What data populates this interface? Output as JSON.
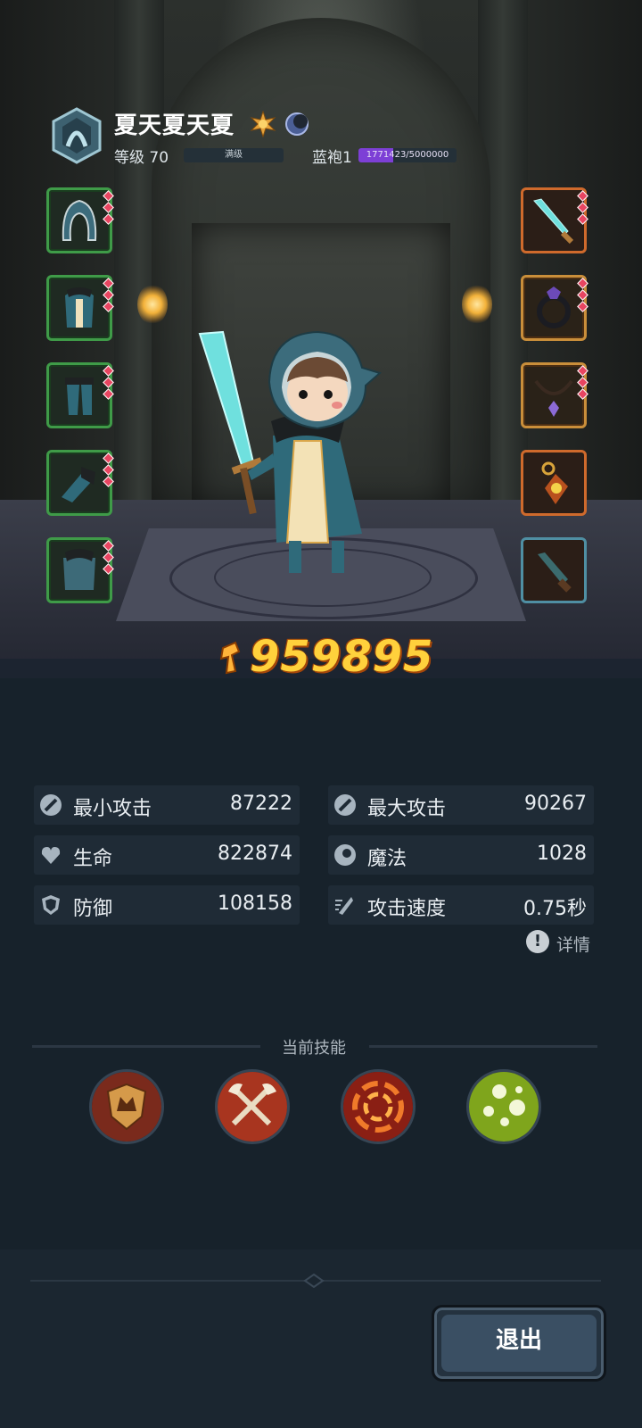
{
  "player": {
    "name": "夏天夏天夏",
    "level_label": "等级 70",
    "level_bar_text": "满级",
    "rank_label": "蓝袍1",
    "rank_progress_text": "1771423/5000000",
    "rank_progress_fraction": 0.354
  },
  "power": {
    "value": "959895"
  },
  "stats": [
    {
      "label": "最小攻击",
      "value": "87222",
      "icon": "sword-icon"
    },
    {
      "label": "最大攻击",
      "value": "90267",
      "icon": "sword-icon"
    },
    {
      "label": "生命",
      "value": "822874",
      "icon": "heart-icon"
    },
    {
      "label": "魔法",
      "value": "1028",
      "icon": "magic-icon"
    },
    {
      "label": "防御",
      "value": "108158",
      "icon": "shield-icon"
    },
    {
      "label": "攻击速度",
      "value": "0.75秒",
      "icon": "speed-icon"
    }
  ],
  "detail": {
    "icon": "!",
    "label": "详情"
  },
  "skills": {
    "title": "当前技能",
    "items": [
      "shield-skill-icon",
      "crossed-axes-skill-icon",
      "fire-vortex-skill-icon",
      "poison-bubbles-skill-icon"
    ]
  },
  "equipment": {
    "left": [
      "hood-icon",
      "robe-icon",
      "pants-icon",
      "gloves-icon",
      "cape-icon"
    ],
    "right": [
      "sword-icon",
      "ring-icon",
      "necklace-icon",
      "amulet-icon",
      "dagger-icon"
    ]
  },
  "exit_label": "退出",
  "colors": {
    "power": "#ffd13c",
    "rank_bar": "#7d3fd6",
    "slot_green": "#3f9b48",
    "slot_gold": "#c98e3a"
  }
}
